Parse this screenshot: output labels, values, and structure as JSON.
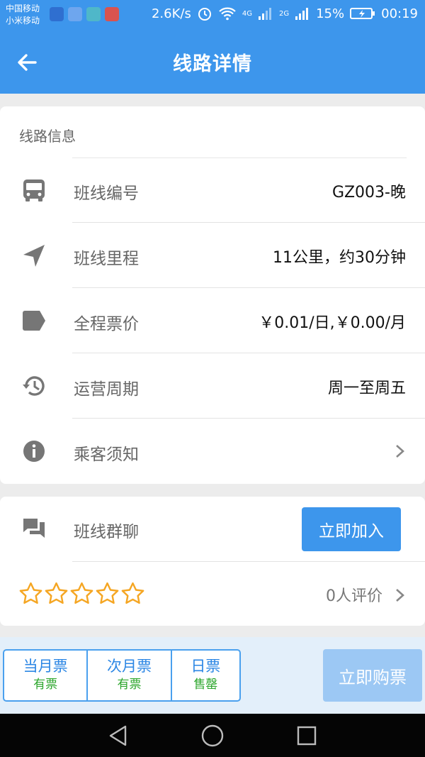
{
  "status_bar": {
    "carrier_1": "中国移动",
    "carrier_2": "小米移动",
    "speed": "2.6K/s",
    "net_4g": "4G",
    "net_2g": "2G",
    "battery": "15%",
    "time": "00:19"
  },
  "header": {
    "title": "线路详情",
    "back_icon": "arrow-left-icon"
  },
  "line_info": {
    "section_title": "线路信息",
    "rows": [
      {
        "icon": "bus-icon",
        "label": "班线编号",
        "value": "GZ003-晚"
      },
      {
        "icon": "navigation-arrow-icon",
        "label": "班线里程",
        "value": "11公里，约30分钟"
      },
      {
        "icon": "price-tag-icon",
        "label": "全程票价",
        "value": "￥0.01/日,￥0.00/月"
      },
      {
        "icon": "history-clock-icon",
        "label": "运营周期",
        "value": "周一至周五"
      },
      {
        "icon": "info-circle-icon",
        "label": "乘客须知",
        "value": ""
      }
    ]
  },
  "group_chat": {
    "icon": "chat-bubbles-icon",
    "label": "班线群聊",
    "join_label": "立即加入"
  },
  "review": {
    "stars_filled": 0,
    "stars_total": 5,
    "count_text": "0人评价"
  },
  "tickets": {
    "tabs": [
      {
        "name": "当月票",
        "status": "有票"
      },
      {
        "name": "次月票",
        "status": "有票"
      },
      {
        "name": "日票",
        "status": "售罄"
      }
    ],
    "buy_label": "立即购票"
  },
  "colors": {
    "primary": "#3d96ec",
    "available": "#2aa52a",
    "star": "#f5a623",
    "buy_disabled": "#9cc8f4"
  }
}
